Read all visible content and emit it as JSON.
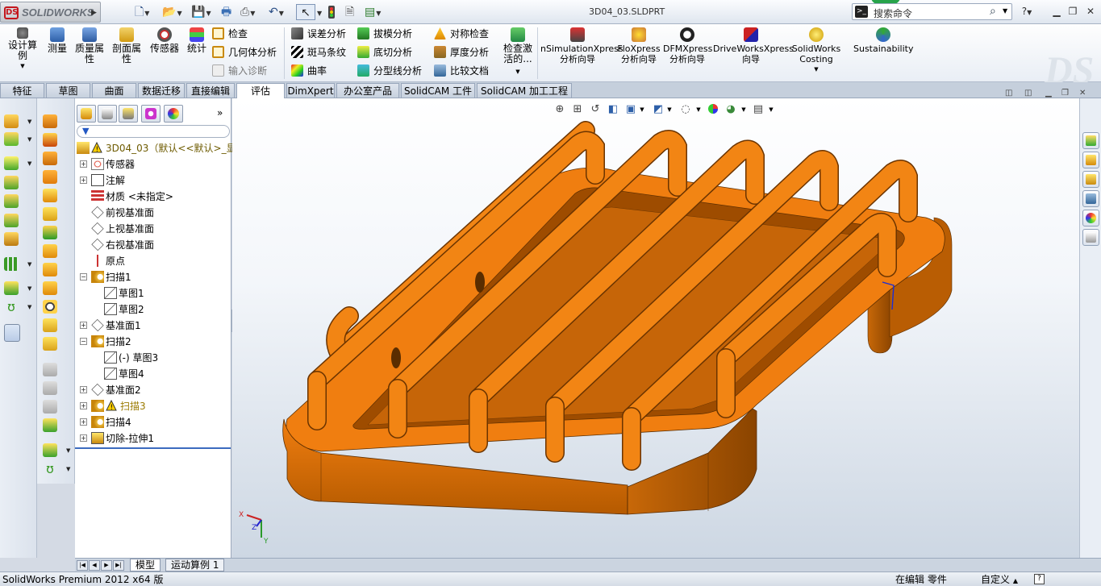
{
  "app": {
    "logo_text": "SOLIDWORKS",
    "doc_title": "3D04_03.SLDPRT"
  },
  "search": {
    "placeholder": "搜索命令"
  },
  "help": {
    "label": "?"
  },
  "commands": {
    "design_study": "设计算例",
    "measure": "测量",
    "mass_props": "质量属性",
    "section_props": "剖面属性",
    "sensor": "传感器",
    "statistics": "统计",
    "check": "检查",
    "geometry_analysis": "几何体分析",
    "import_diagnostics": "输入诊断",
    "deviation": "误差分析",
    "zebra": "斑马条纹",
    "curvature": "曲率",
    "draft": "拔模分析",
    "undercut": "底切分析",
    "parting": "分型线分析",
    "symmetry": "对称检查",
    "thickness": "厚度分析",
    "compare": "比较文档",
    "check_active": "检查激活的...",
    "nsim": "nSimulationXpress 分析向导",
    "floxpress": "FloXpress 分析向导",
    "dfm": "DFMXpress 分析向导",
    "driveworks": "DriveWorksXpress 向导",
    "costing": "SolidWorks Costing",
    "sustainability": "Sustainability"
  },
  "tabs": [
    "特征",
    "草图",
    "曲面",
    "数据迁移",
    "直接编辑",
    "评估",
    "DimXpert",
    "办公室产品",
    "SolidCAM 工件",
    "SolidCAM 加工工程"
  ],
  "active_tab": "评估",
  "tree": {
    "root": "3D04_03（默认<<默认>_显",
    "items": [
      "传感器",
      "注解",
      "材质 <未指定>",
      "前视基准面",
      "上视基准面",
      "右视基准面",
      "原点",
      "扫描1",
      "草图1",
      "草图2",
      "基准面1",
      "扫描2",
      "(-) 草图3",
      "草图4",
      "基准面2",
      "扫描3",
      "扫描4",
      "切除-拉伸1"
    ]
  },
  "bottom_tabs": [
    "模型",
    "运动算例 1"
  ],
  "status": {
    "left": "SolidWorks Premium 2012 x64 版",
    "edit": "在编辑 零件",
    "custom": "自定义"
  },
  "tripod": {
    "x": "X",
    "y": "Y",
    "z": "Z"
  },
  "colors": {
    "part": "#f07e10",
    "part_dark": "#b85b00",
    "bg_top": "#ffffff",
    "bg_bottom": "#cdd7e3"
  }
}
